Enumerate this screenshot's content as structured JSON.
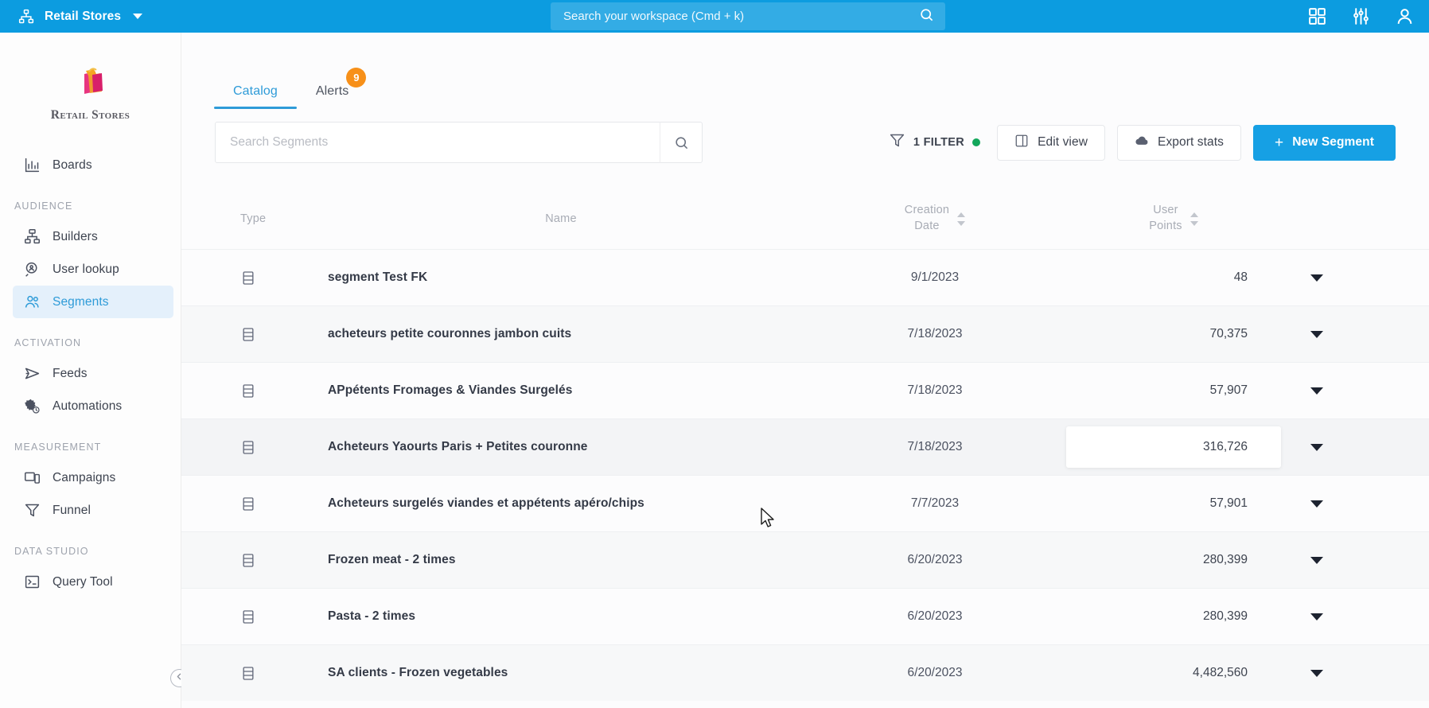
{
  "topbar": {
    "org_icon": "org-hierarchy-icon",
    "org_name": "Retail Stores",
    "search_placeholder": "Search your workspace (Cmd + k)",
    "search_value": "",
    "icons": [
      "apps-grid-icon",
      "sliders-settings-icon",
      "user-account-icon"
    ]
  },
  "sidebar": {
    "logo_text": "Retail Stores",
    "top_items": [
      {
        "label": "Boards",
        "icon": "bar-chart-icon",
        "active": false
      }
    ],
    "sections": [
      {
        "label": "AUDIENCE",
        "items": [
          {
            "label": "Builders",
            "icon": "sitemap-icon",
            "active": false
          },
          {
            "label": "User lookup",
            "icon": "magnifier-person-icon",
            "active": false
          },
          {
            "label": "Segments",
            "icon": "people-group-icon",
            "active": true
          }
        ]
      },
      {
        "label": "ACTIVATION",
        "items": [
          {
            "label": "Feeds",
            "icon": "paper-plane-icon",
            "active": false
          },
          {
            "label": "Automations",
            "icon": "gear-clock-icon",
            "active": false
          }
        ]
      },
      {
        "label": "MEASUREMENT",
        "items": [
          {
            "label": "Campaigns",
            "icon": "devices-icon",
            "active": false
          },
          {
            "label": "Funnel",
            "icon": "funnel-icon",
            "active": false
          }
        ]
      },
      {
        "label": "DATA STUDIO",
        "items": [
          {
            "label": "Query Tool",
            "icon": "terminal-icon",
            "active": false
          }
        ]
      }
    ],
    "collapse_icon": "chevron-left-circle-icon"
  },
  "main": {
    "tabs": [
      {
        "label": "Catalog",
        "active": true,
        "badge": null
      },
      {
        "label": "Alerts",
        "active": false,
        "badge": "9"
      }
    ],
    "toolbar": {
      "search_placeholder": "Search Segments",
      "search_value": "",
      "search_icon": "search-icon",
      "filter_label": "1 FILTER",
      "filter_icon": "funnel-icon",
      "filter_dot_color": "#13a75b",
      "edit_view_label": "Edit view",
      "edit_view_icon": "layout-panel-icon",
      "export_label": "Export stats",
      "export_icon": "cloud-download-icon",
      "new_segment_label": "New Segment",
      "new_segment_plus": "+",
      "primary_color": "#16a0e4"
    },
    "table": {
      "columns": {
        "type": "Type",
        "name": "Name",
        "creation_date_line1": "Creation",
        "creation_date_line2": "Date",
        "user_points_line1": "User",
        "user_points_line2": "Points"
      },
      "rows": [
        {
          "type_icon": "segment-rows-icon",
          "name": "segment Test FK",
          "date": "9/1/2023",
          "points": "48"
        },
        {
          "type_icon": "segment-rows-icon",
          "name": "acheteurs petite couronnes jambon cuits",
          "date": "7/18/2023",
          "points": "70,375"
        },
        {
          "type_icon": "segment-rows-icon",
          "name": "APpétents Fromages & Viandes Surgelés",
          "date": "7/18/2023",
          "points": "57,907"
        },
        {
          "type_icon": "segment-rows-icon",
          "name": "Acheteurs Yaourts Paris + Petites couronne",
          "date": "7/18/2023",
          "points": "316,726"
        },
        {
          "type_icon": "segment-rows-icon",
          "name": "Acheteurs surgelés viandes et appétents apéro/chips",
          "date": "7/7/2023",
          "points": "57,901"
        },
        {
          "type_icon": "segment-rows-icon",
          "name": "Frozen meat - 2 times",
          "date": "6/20/2023",
          "points": "280,399"
        },
        {
          "type_icon": "segment-rows-icon",
          "name": "Pasta - 2 times",
          "date": "6/20/2023",
          "points": "280,399"
        },
        {
          "type_icon": "segment-rows-icon",
          "name": "SA clients - Frozen vegetables",
          "date": "6/20/2023",
          "points": "4,482,560"
        }
      ]
    }
  }
}
